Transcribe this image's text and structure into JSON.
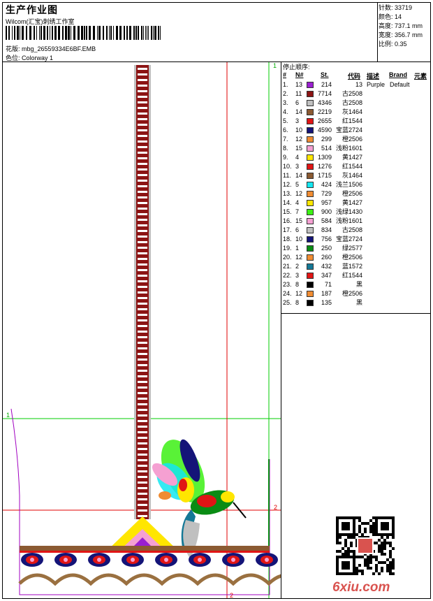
{
  "header": {
    "title": "生产作业图",
    "company": "Wilcom(汇宝)刺绣工作室",
    "design_label": "花版:",
    "design_value": "mbg_26559334E6BF.EMB",
    "colorway_label": "色位:",
    "colorway_value": "Colorway 1"
  },
  "stats": [
    {
      "label": "针数:",
      "value": "33719"
    },
    {
      "label": "颜色:",
      "value": "14"
    },
    {
      "label": "高度:",
      "value": "737.1 mm"
    },
    {
      "label": "宽度:",
      "value": "356.7 mm"
    },
    {
      "label": "比例:",
      "value": "0.35"
    }
  ],
  "stop_sequence": {
    "title": "停止顺序:",
    "headers": {
      "num": "#",
      "n": "N#",
      "st": "St.",
      "code": "代码",
      "desc": "描述",
      "brand": "Brand",
      "elem": "元素"
    },
    "rows": [
      {
        "num": "1.",
        "n": "13",
        "color": "#9a1fd0",
        "st": "214",
        "code": "13",
        "desc": "Purple",
        "brand": "Default"
      },
      {
        "num": "2.",
        "n": "11",
        "color": "#8c1414",
        "st": "7714",
        "code": "古2508",
        "desc": "",
        "brand": ""
      },
      {
        "num": "3.",
        "n": "6",
        "color": "#c0c0c0",
        "st": "4346",
        "code": "古2508",
        "desc": "",
        "brand": ""
      },
      {
        "num": "4.",
        "n": "14",
        "color": "#8b5a32",
        "st": "2219",
        "code": "灰1464",
        "desc": "",
        "brand": ""
      },
      {
        "num": "5.",
        "n": "3",
        "color": "#e01515",
        "st": "2655",
        "code": "红1544",
        "desc": "",
        "brand": ""
      },
      {
        "num": "6.",
        "n": "10",
        "color": "#141478",
        "st": "4590",
        "code": "宝蓝2724",
        "desc": "",
        "brand": ""
      },
      {
        "num": "7.",
        "n": "12",
        "color": "#f08c32",
        "st": "299",
        "code": "橙2506",
        "desc": "",
        "brand": ""
      },
      {
        "num": "8.",
        "n": "15",
        "color": "#f5a0d2",
        "st": "514",
        "code": "浅粉1601",
        "desc": "",
        "brand": ""
      },
      {
        "num": "9.",
        "n": "4",
        "color": "#ffe600",
        "st": "1309",
        "code": "黄1427",
        "desc": "",
        "brand": ""
      },
      {
        "num": "10.",
        "n": "3",
        "color": "#e01515",
        "st": "1276",
        "code": "红1544",
        "desc": "",
        "brand": ""
      },
      {
        "num": "11.",
        "n": "14",
        "color": "#8b5a32",
        "st": "1715",
        "code": "灰1464",
        "desc": "",
        "brand": ""
      },
      {
        "num": "12.",
        "n": "5",
        "color": "#14e6f0",
        "st": "424",
        "code": "浅兰1506",
        "desc": "",
        "brand": ""
      },
      {
        "num": "13.",
        "n": "12",
        "color": "#f08c32",
        "st": "729",
        "code": "橙2506",
        "desc": "",
        "brand": ""
      },
      {
        "num": "14.",
        "n": "4",
        "color": "#ffe600",
        "st": "957",
        "code": "黄1427",
        "desc": "",
        "brand": ""
      },
      {
        "num": "15.",
        "n": "7",
        "color": "#3cf014",
        "st": "900",
        "code": "浅绿1430",
        "desc": "",
        "brand": ""
      },
      {
        "num": "16.",
        "n": "15",
        "color": "#f5a0d2",
        "st": "584",
        "code": "浅粉1601",
        "desc": "",
        "brand": ""
      },
      {
        "num": "17.",
        "n": "6",
        "color": "#c0c0c0",
        "st": "834",
        "code": "古2508",
        "desc": "",
        "brand": ""
      },
      {
        "num": "18.",
        "n": "10",
        "color": "#141478",
        "st": "756",
        "code": "宝蓝2724",
        "desc": "",
        "brand": ""
      },
      {
        "num": "19.",
        "n": "1",
        "color": "#0a8c14",
        "st": "250",
        "code": "绿2577",
        "desc": "",
        "brand": ""
      },
      {
        "num": "20.",
        "n": "12",
        "color": "#f08c32",
        "st": "260",
        "code": "橙2506",
        "desc": "",
        "brand": ""
      },
      {
        "num": "21.",
        "n": "2",
        "color": "#147896",
        "st": "432",
        "code": "蓝1572",
        "desc": "",
        "brand": ""
      },
      {
        "num": "22.",
        "n": "3",
        "color": "#e01515",
        "st": "347",
        "code": "红1544",
        "desc": "",
        "brand": ""
      },
      {
        "num": "23.",
        "n": "8",
        "color": "#000000",
        "st": "71",
        "code": "黑",
        "desc": "",
        "brand": ""
      },
      {
        "num": "24.",
        "n": "12",
        "color": "#f08c32",
        "st": "187",
        "code": "橙2506",
        "desc": "",
        "brand": ""
      },
      {
        "num": "25.",
        "n": "8",
        "color": "#000000",
        "st": "135",
        "code": "黑",
        "desc": "",
        "brand": ""
      }
    ]
  },
  "guides": {
    "mark_1": "1",
    "mark_2": "2"
  },
  "watermark": "6xiu.com",
  "colors": {
    "green_guide": "#00cc00",
    "red_guide": "#e00000",
    "purple_outline": "#a000c0"
  }
}
